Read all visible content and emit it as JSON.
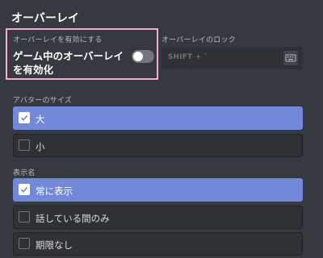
{
  "header": {
    "title": "オーバーレイ"
  },
  "enable_section": {
    "label": "オーバーレイを有効にする",
    "toggle_text": "ゲーム中のオーバーレイを有効化",
    "toggle_on": false
  },
  "lock_section": {
    "label": "オーバーレイのロック",
    "keybind": "SHIFT + `",
    "icon": "keyboard-icon"
  },
  "avatar_size": {
    "label": "アバターのサイズ",
    "options": [
      {
        "label": "大",
        "checked": true
      },
      {
        "label": "小",
        "checked": false
      }
    ]
  },
  "display_names": {
    "label": "表示名",
    "options": [
      {
        "label": "常に表示",
        "checked": true
      },
      {
        "label": "話している間のみ",
        "checked": false
      },
      {
        "label": "期限なし",
        "checked": false
      }
    ]
  },
  "colors": {
    "accent": "#7289da",
    "highlight_border": "#f9a8d4",
    "background": "#36393f"
  }
}
